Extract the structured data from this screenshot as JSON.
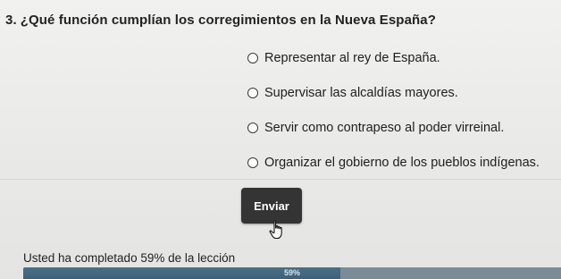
{
  "question": {
    "number": "3.",
    "text": "¿Qué función cumplían los corregimientos en la Nueva España?"
  },
  "options": [
    {
      "label": "Representar al rey de España."
    },
    {
      "label": "Supervisar las alcaldías mayores."
    },
    {
      "label": "Servir como contrapeso al poder virreinal."
    },
    {
      "label": "Organizar el gobierno de los pueblos indígenas."
    }
  ],
  "submit_label": "Enviar",
  "progress": {
    "text": "Usted ha completado 59% de la lección",
    "label": "59%",
    "value": 0.59
  },
  "icons": {
    "cursor": "hand-pointer-icon"
  },
  "colors": {
    "button": "#343434",
    "progress_fill": "#46697f",
    "progress_track": "#7b8c97"
  }
}
